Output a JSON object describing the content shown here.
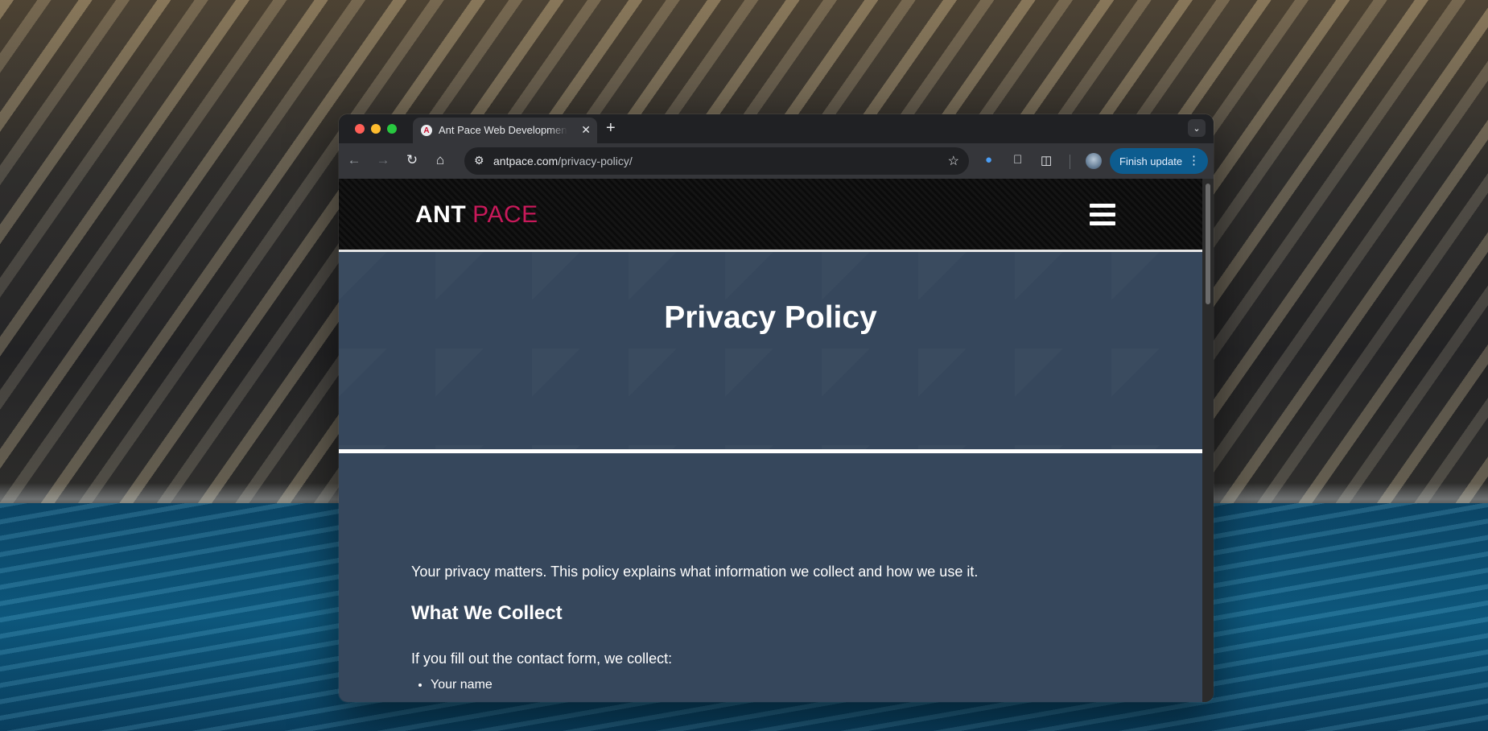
{
  "browser": {
    "tab_title": "Ant Pace Web Development –",
    "tab_favicon": "A",
    "tab_close": "✕",
    "new_tab": "+",
    "url_domain": "antpace.com",
    "url_path": "/privacy-policy/",
    "finish_update_label": "Finish update",
    "icons": {
      "back": "arrow-left-icon",
      "forward": "arrow-right-icon",
      "reload": "reload-icon",
      "home": "home-icon",
      "bookmark": "star-icon",
      "extensions": "puzzle-icon"
    }
  },
  "site": {
    "logo_ant": "ANT",
    "logo_pace": "PACE",
    "accent_color": "#c8195a",
    "background_color": "#36475c"
  },
  "page": {
    "title": "Privacy Policy",
    "intro": "Your privacy matters. This policy explains what information we collect and how we use it.",
    "section_heading": "What We Collect",
    "collect_intro": "If you fill out the contact form, we collect:",
    "collect_items": [
      "Your name"
    ]
  }
}
